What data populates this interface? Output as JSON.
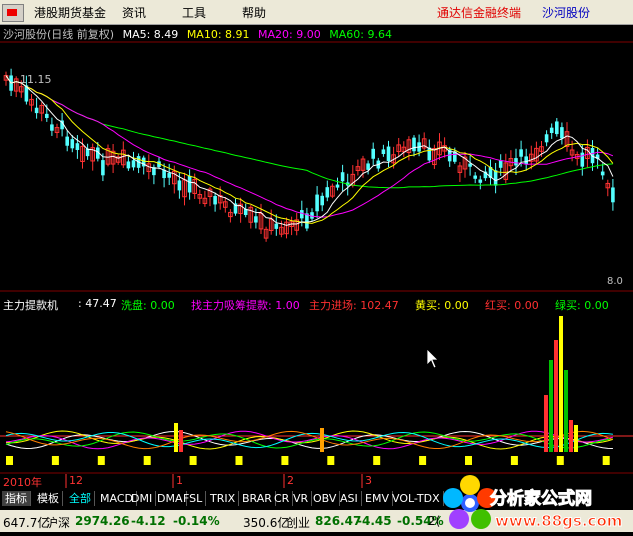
{
  "menu": {
    "items": [
      "港股期货基金",
      "资讯",
      "工具",
      "帮助"
    ],
    "right_title_1": "通达信金融终端",
    "right_title_2": "沙河股份"
  },
  "chart_header": {
    "title": "沙河股份(日线 前复权)",
    "ma5": "MA5: 8.49",
    "ma10": "MA10: 8.91",
    "ma20": "MA20: 9.00",
    "ma60": "MA60: 9.64",
    "high_label": "11.15",
    "low_label": "8.0"
  },
  "indicator_header": {
    "name": "主力提款机",
    "value": ": 47.47",
    "xipan": "洗盘: 0.00",
    "xichou": "找主力吸筹提款: 1.00",
    "jinchang": "主力进场: 102.47",
    "huangmai": "黄买: 0.00",
    "hongmai": "红买: 0.00",
    "lvmai": "绿买: 0.00"
  },
  "dates": [
    "2010年",
    "12",
    "1",
    "2",
    "3"
  ],
  "tabs": [
    "指标",
    "模板",
    "全部",
    "MACD",
    "DMI",
    "DMA",
    "FSL",
    "TRIX",
    "BRAR",
    "CR",
    "VR",
    "OBV",
    "ASI",
    "EMV",
    "VOL-TDX"
  ],
  "status": {
    "vol1": "647.7亿",
    "idx1_name": "沪深",
    "idx1_val": "2974.26",
    "idx1_chg": "-4.12",
    "idx1_pct": "-0.14%",
    "vol2": "350.6亿",
    "idx2_name": "创业",
    "idx2_val": "826.47",
    "idx2_chg": "-4.45",
    "idx2_pct": "-0.54%",
    "vol3": "2("
  },
  "watermark": {
    "line1": "分析家公式网",
    "line2": "www.88gs.com"
  },
  "colors": {
    "up": "#ff3232",
    "down": "#54ffff",
    "ma5": "#ffffff",
    "ma10": "#ffff00",
    "ma20": "#ff00ff",
    "ma60": "#00ff00"
  }
}
